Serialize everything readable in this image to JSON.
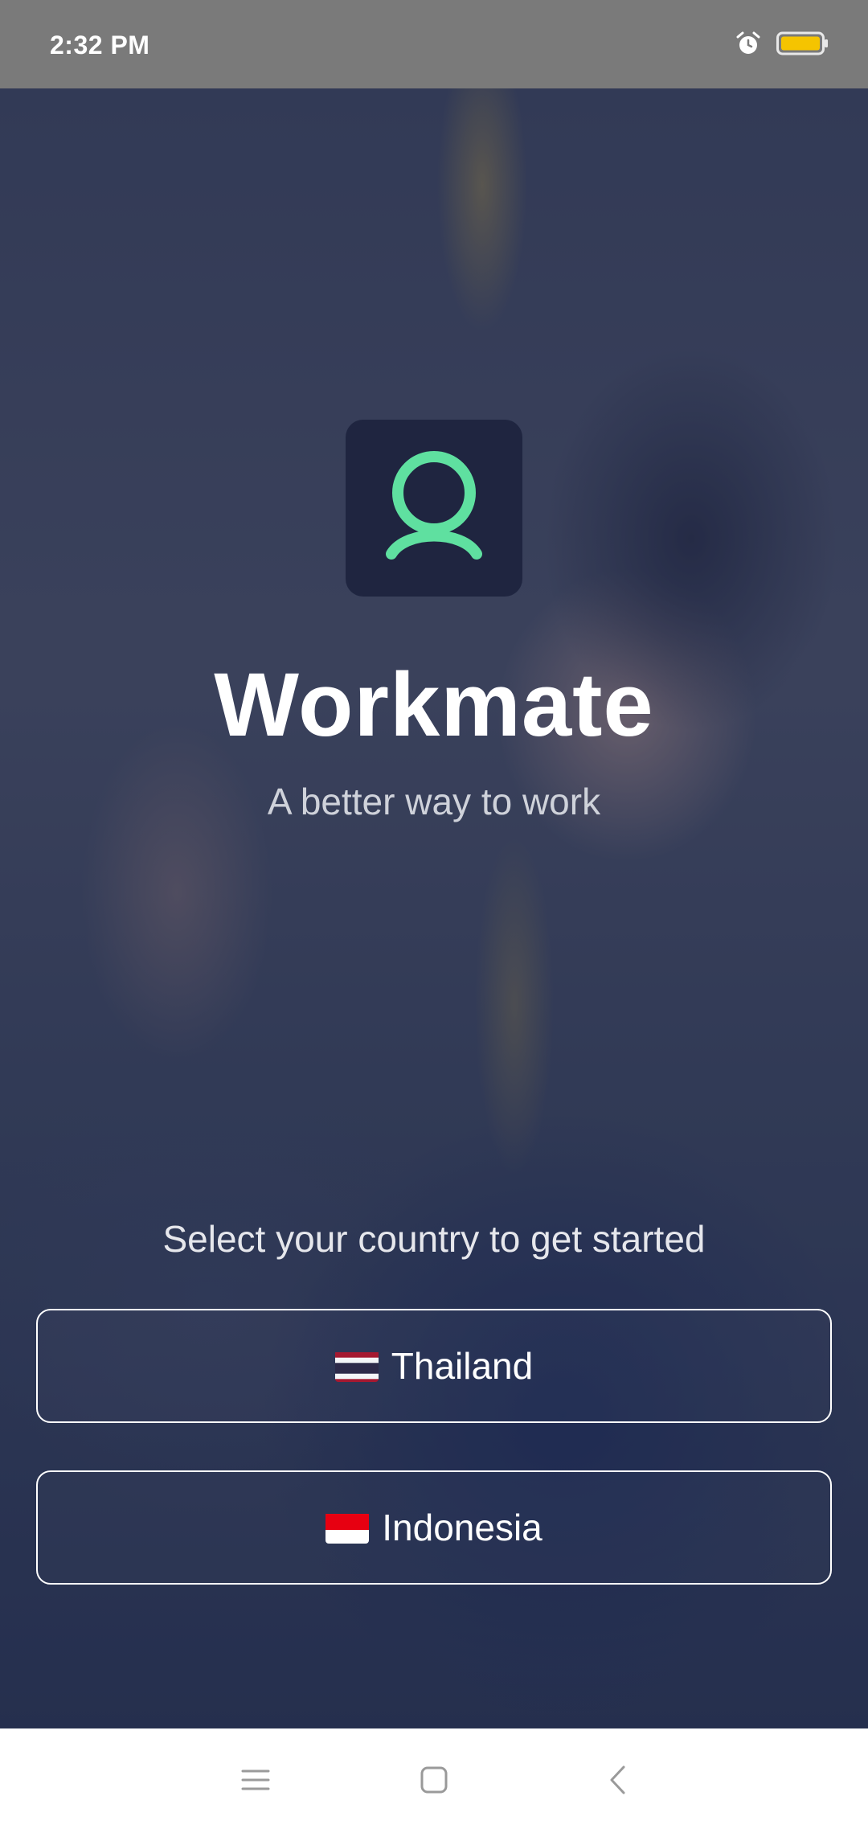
{
  "status_bar": {
    "time": "2:32 PM",
    "icons": [
      "alarm-icon",
      "battery-icon"
    ],
    "battery_color": "#f5c400"
  },
  "app": {
    "logo_icon": "user-icon",
    "logo_bg": "#1f2540",
    "logo_accent": "#5fe0a0",
    "title": "Workmate",
    "subtitle": "A better way to work"
  },
  "country_select": {
    "prompt": "Select your country to get started",
    "options": [
      {
        "flag_icon": "thailand-flag-icon",
        "label": "Thailand"
      },
      {
        "flag_icon": "indonesia-flag-icon",
        "label": "Indonesia"
      }
    ]
  },
  "nav_bar": {
    "buttons": [
      "menu-icon",
      "home-icon",
      "back-icon"
    ]
  }
}
